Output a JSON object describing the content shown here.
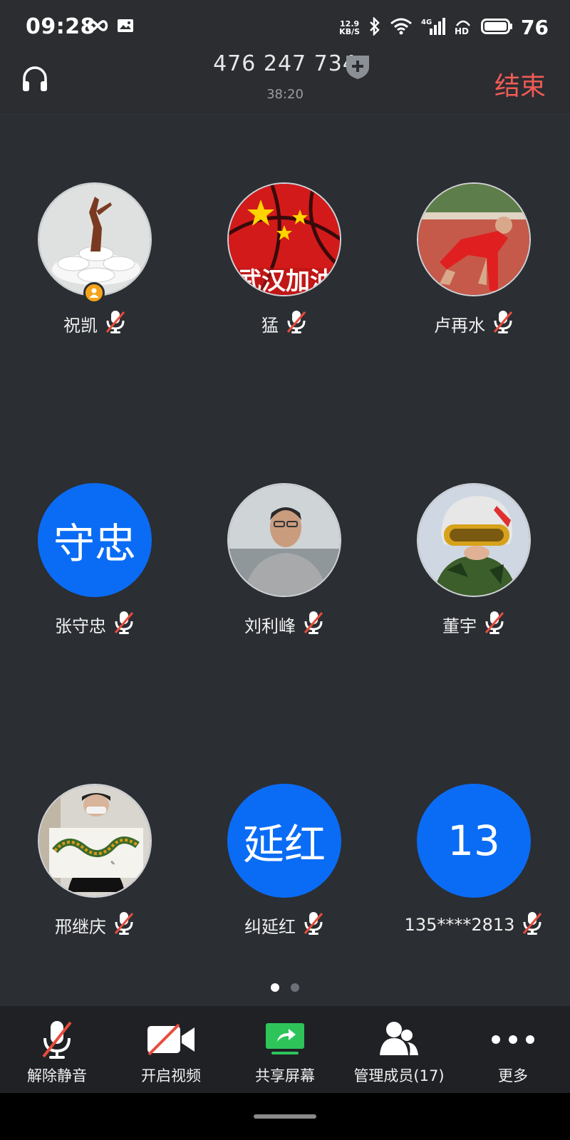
{
  "status_bar": {
    "time": "09:28",
    "net_speed_value": "12.9",
    "net_speed_unit": "KB/S",
    "network_type": "4G",
    "hd_label": "HD",
    "battery_level": "76",
    "icons": [
      "infinity-icon",
      "image-icon",
      "bluetooth-icon",
      "wifi-icon",
      "signal-icon",
      "hd-voice-icon",
      "battery-icon"
    ]
  },
  "header": {
    "meeting_id": "476 247 734",
    "duration": "38:20",
    "end_label": "结束"
  },
  "participants": [
    {
      "name": "祝凯",
      "avatar_type": "photo",
      "avatar_desc": "statue-icon",
      "host": true,
      "muted": true
    },
    {
      "name": "猛",
      "avatar_type": "photo",
      "avatar_text": "武汉加油",
      "host": false,
      "muted": true
    },
    {
      "name": "卢再水",
      "avatar_type": "photo",
      "avatar_desc": "runner-icon",
      "host": false,
      "muted": true
    },
    {
      "name": "张守忠",
      "avatar_type": "text",
      "avatar_text": "守忠",
      "host": false,
      "muted": true
    },
    {
      "name": "刘利峰",
      "avatar_type": "photo",
      "avatar_desc": "person-icon",
      "host": false,
      "muted": true
    },
    {
      "name": "董宇",
      "avatar_type": "photo",
      "avatar_desc": "helmet-child-icon",
      "host": false,
      "muted": true
    },
    {
      "name": "邢继庆",
      "avatar_type": "photo",
      "avatar_desc": "dragon-painting-icon",
      "host": false,
      "muted": true
    },
    {
      "name": "纠延红",
      "avatar_type": "text",
      "avatar_text": "延红",
      "host": false,
      "muted": true
    },
    {
      "name": "135****2813",
      "avatar_type": "text",
      "avatar_text": "13",
      "host": false,
      "muted": true
    }
  ],
  "pagination": {
    "pages": 2,
    "current": 1
  },
  "toolbar": {
    "unmute_label": "解除静音",
    "video_label": "开启视频",
    "share_label": "共享屏幕",
    "members_label": "管理成员(17)",
    "more_label": "更多"
  },
  "colors": {
    "background": "#2b2e33",
    "accent_blue": "#0a6cf5",
    "end_red": "#f15b55",
    "share_green": "#2ec45a",
    "host_badge": "#f5a31a"
  }
}
